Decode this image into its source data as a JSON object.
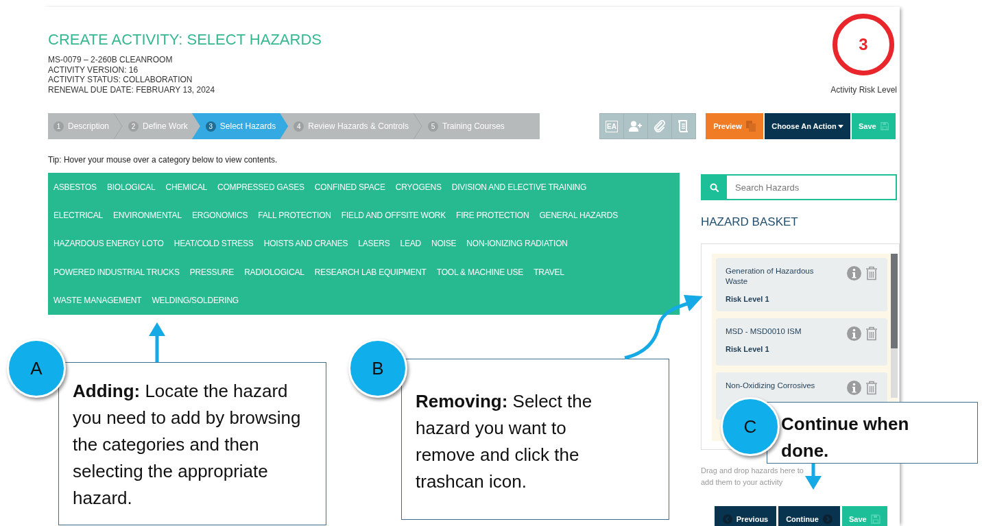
{
  "page": {
    "title": "CREATE ACTIVITY: SELECT HAZARDS",
    "details": [
      "MS-0079 – 2-260B CLEANROOM",
      "ACTIVITY VERSION: 16",
      "ACTIVITY STATUS: COLLABORATION",
      "RENEWAL DUE DATE: FEBRUARY 13, 2024"
    ]
  },
  "risk": {
    "value": "3",
    "label": "Activity Risk Level"
  },
  "steps": [
    {
      "number": "1",
      "label": "Description",
      "selected": false
    },
    {
      "number": "2",
      "label": "Define Work",
      "selected": false
    },
    {
      "number": "3",
      "label": "Select Hazards",
      "selected": true
    },
    {
      "number": "4",
      "label": "Review Hazards & Controls",
      "selected": false
    },
    {
      "number": "5",
      "label": "Training Courses",
      "selected": false
    }
  ],
  "tools": [
    {
      "kind": "ea",
      "text": "EA"
    },
    {
      "kind": "add-person"
    },
    {
      "kind": "attach"
    },
    {
      "kind": "scroll"
    }
  ],
  "actions": [
    {
      "kind": "preview",
      "label": "Preview"
    },
    {
      "kind": "menu",
      "label": "Choose An Action"
    },
    {
      "kind": "save",
      "label": "Save"
    }
  ],
  "tip": "Tip: Hover your mouse over a category below to view contents.",
  "category_rows": [
    [
      "ASBESTOS",
      "BIOLOGICAL",
      "CHEMICAL",
      "COMPRESSED GASES",
      "CONFINED SPACE",
      "CRYOGENS",
      "DIVISION AND ELECTIVE TRAINING"
    ],
    [
      "ELECTRICAL",
      "ENVIRONMENTAL",
      "ERGONOMICS",
      "FALL PROTECTION",
      "FIELD AND OFFSITE WORK",
      "FIRE PROTECTION",
      "GENERAL HAZARDS"
    ],
    [
      "HAZARDOUS ENERGY LOTO",
      "HEAT/COLD STRESS",
      "HOISTS AND CRANES",
      "LASERS",
      "LEAD",
      "NOISE",
      "NON-IONIZING RADIATION"
    ],
    [
      "POWERED INDUSTRIAL TRUCKS",
      "PRESSURE",
      "RADIOLOGICAL",
      "RESEARCH LAB EQUIPMENT",
      "TOOL & MACHINE USE",
      "TRAVEL"
    ],
    [
      "WASTE MANAGEMENT",
      "WELDING/SOLDERING"
    ]
  ],
  "search": {
    "placeholder": "Search Hazards"
  },
  "basket": {
    "title": "HAZARD BASKET",
    "items": [
      {
        "name": "Generation of Hazardous Waste",
        "risk": "Risk Level 1"
      },
      {
        "name": "MSD - MSD0010 ISM",
        "risk": "Risk Level 1"
      },
      {
        "name": "Non-Oxidizing Corrosives"
      }
    ],
    "hint": "Drag and drop hazards here to add them to your activity"
  },
  "nav": [
    {
      "kind": "previous",
      "label": "Previous"
    },
    {
      "kind": "continue",
      "label": "Continue"
    },
    {
      "kind": "save",
      "label": "Save"
    }
  ],
  "callouts": [
    {
      "letter": "A",
      "kind": "note",
      "text": "**Adding:** Locate the hazard you need to add by browsing the categories and then selecting the appropriate hazard."
    },
    {
      "letter": "B",
      "kind": "note",
      "text": "**Removing:** Select the hazard you want to remove and click the trashcan icon."
    },
    {
      "letter": "C",
      "kind": "action",
      "text": "Continue when done."
    }
  ]
}
